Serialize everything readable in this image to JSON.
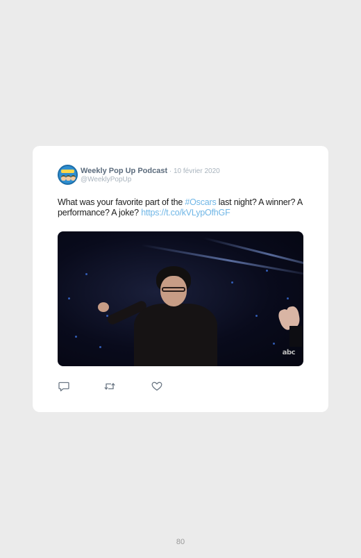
{
  "tweet": {
    "author_name": "Weekly Pop Up Podcast",
    "separator": " · ",
    "date": "10 février 2020",
    "handle": "@WeeklyPopUp",
    "text_before_hashtag": "What was your favorite part of the ",
    "hashtag": "#Oscars",
    "text_after_hashtag": " last night? A winner? A performance? A joke? ",
    "link": "https://t.co/kVLypOfhGF",
    "media": {
      "watermark": "abc"
    },
    "actions": [
      {
        "name": "reply",
        "icon": "comment-icon"
      },
      {
        "name": "retweet",
        "icon": "retweet-icon"
      },
      {
        "name": "like",
        "icon": "heart-icon"
      }
    ]
  },
  "page": {
    "number": "80"
  },
  "colors": {
    "background": "#ebebeb",
    "card": "#ffffff",
    "link": "#6fb6e6",
    "author": "#5b6b7c",
    "muted": "#a8b3bd"
  }
}
